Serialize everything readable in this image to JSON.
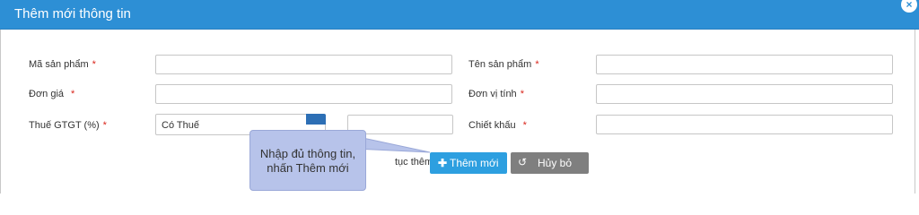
{
  "dialog": {
    "title": "Thêm mới thông tin",
    "close_glyph": "×"
  },
  "form": {
    "ma_san_pham": {
      "label": "Mã sản phẩm",
      "required": "*",
      "value": ""
    },
    "ten_san_pham": {
      "label": "Tên sản phẩm",
      "required": "*",
      "value": ""
    },
    "don_gia": {
      "label": "Đơn giá",
      "required": "*",
      "value": ""
    },
    "don_vi_tinh": {
      "label": "Đơn vị tính",
      "required": "*",
      "value": ""
    },
    "thue_gtgt": {
      "label": "Thuế GTGT (%)",
      "required": "*",
      "selected": "Có Thuế",
      "rate_value": ""
    },
    "chiet_khau": {
      "label": "Chiết khấu",
      "required": "*",
      "value": ""
    }
  },
  "tooltip": {
    "line1": "Nhập đủ thông tin,",
    "line2": "nhấn Thêm mới"
  },
  "footer": {
    "continue_text": "tục thêm mới",
    "add_button": {
      "icon": "plus-icon",
      "label": "Thêm mới"
    },
    "cancel_button": {
      "icon": "undo-icon",
      "label": "Hủy bỏ"
    }
  },
  "colors": {
    "header": "#2d8fd5",
    "add_button": "#2d9fe0",
    "cancel_button": "#7f7f7f",
    "tooltip": "#b7c3ea",
    "required": "#d9261c"
  }
}
